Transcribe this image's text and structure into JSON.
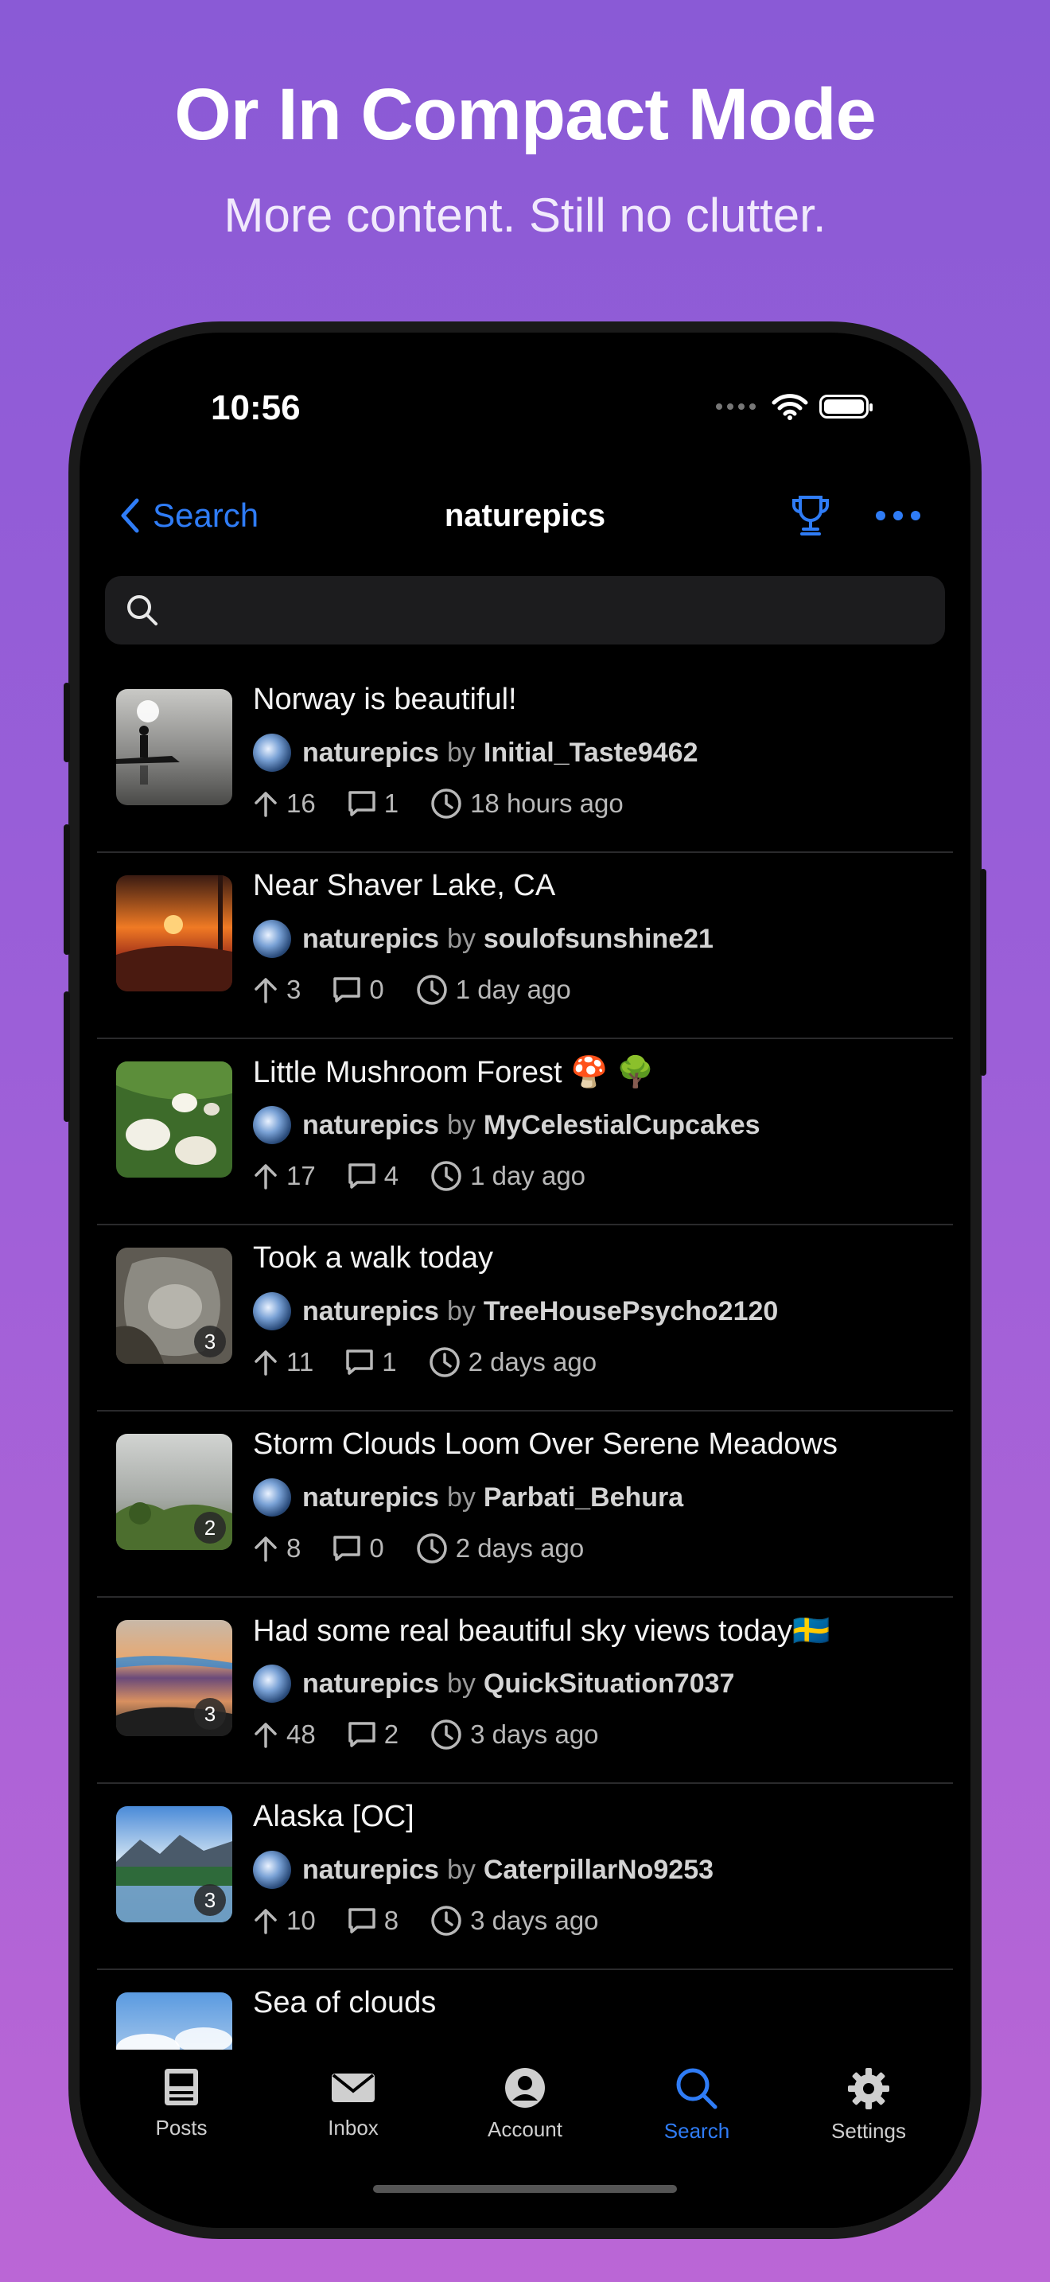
{
  "marketing": {
    "headline": "Or In Compact Mode",
    "subheadline": "More content. Still no clutter."
  },
  "status_bar": {
    "time": "10:56"
  },
  "nav": {
    "back_label": "Search",
    "title": "naturepics"
  },
  "search": {
    "placeholder": ""
  },
  "posts": [
    {
      "title": "Norway is beautiful!",
      "community": "naturepics",
      "by": "by",
      "author": "Initial_Taste9462",
      "upvotes": "16",
      "comments": "1",
      "time": "18 hours ago",
      "image_count": ""
    },
    {
      "title": "Near Shaver Lake, CA",
      "community": "naturepics",
      "by": "by",
      "author": "soulofsunshine21",
      "upvotes": "3",
      "comments": "0",
      "time": "1 day ago",
      "image_count": ""
    },
    {
      "title": "Little Mushroom Forest 🍄 🌳",
      "community": "naturepics",
      "by": "by",
      "author": "MyCelestialCupcakes",
      "upvotes": "17",
      "comments": "4",
      "time": "1 day ago",
      "image_count": ""
    },
    {
      "title": "Took a walk today",
      "community": "naturepics",
      "by": "by",
      "author": "TreeHousePsycho2120",
      "upvotes": "11",
      "comments": "1",
      "time": "2 days ago",
      "image_count": "3"
    },
    {
      "title": "Storm Clouds Loom Over Serene Meadows",
      "community": "naturepics",
      "by": "by",
      "author": "Parbati_Behura",
      "upvotes": "8",
      "comments": "0",
      "time": "2 days ago",
      "image_count": "2"
    },
    {
      "title": "Had some real beautiful sky views today🇸🇪",
      "community": "naturepics",
      "by": "by",
      "author": "QuickSituation7037",
      "upvotes": "48",
      "comments": "2",
      "time": "3 days ago",
      "image_count": "3"
    },
    {
      "title": "Alaska [OC]",
      "community": "naturepics",
      "by": "by",
      "author": "CaterpillarNo9253",
      "upvotes": "10",
      "comments": "8",
      "time": "3 days ago",
      "image_count": "3"
    },
    {
      "title": "Sea of clouds",
      "community": "",
      "by": "",
      "author": "",
      "upvotes": "",
      "comments": "",
      "time": "",
      "image_count": ""
    }
  ],
  "tabs": [
    {
      "label": "Posts",
      "icon": "posts-icon",
      "active": false
    },
    {
      "label": "Inbox",
      "icon": "inbox-icon",
      "active": false
    },
    {
      "label": "Account",
      "icon": "account-icon",
      "active": false
    },
    {
      "label": "Search",
      "icon": "search-icon",
      "active": true
    },
    {
      "label": "Settings",
      "icon": "gear-icon",
      "active": false
    }
  ],
  "colors": {
    "accent": "#2f7cf6",
    "background": "#000000",
    "text_secondary": "#b8b8b8"
  }
}
